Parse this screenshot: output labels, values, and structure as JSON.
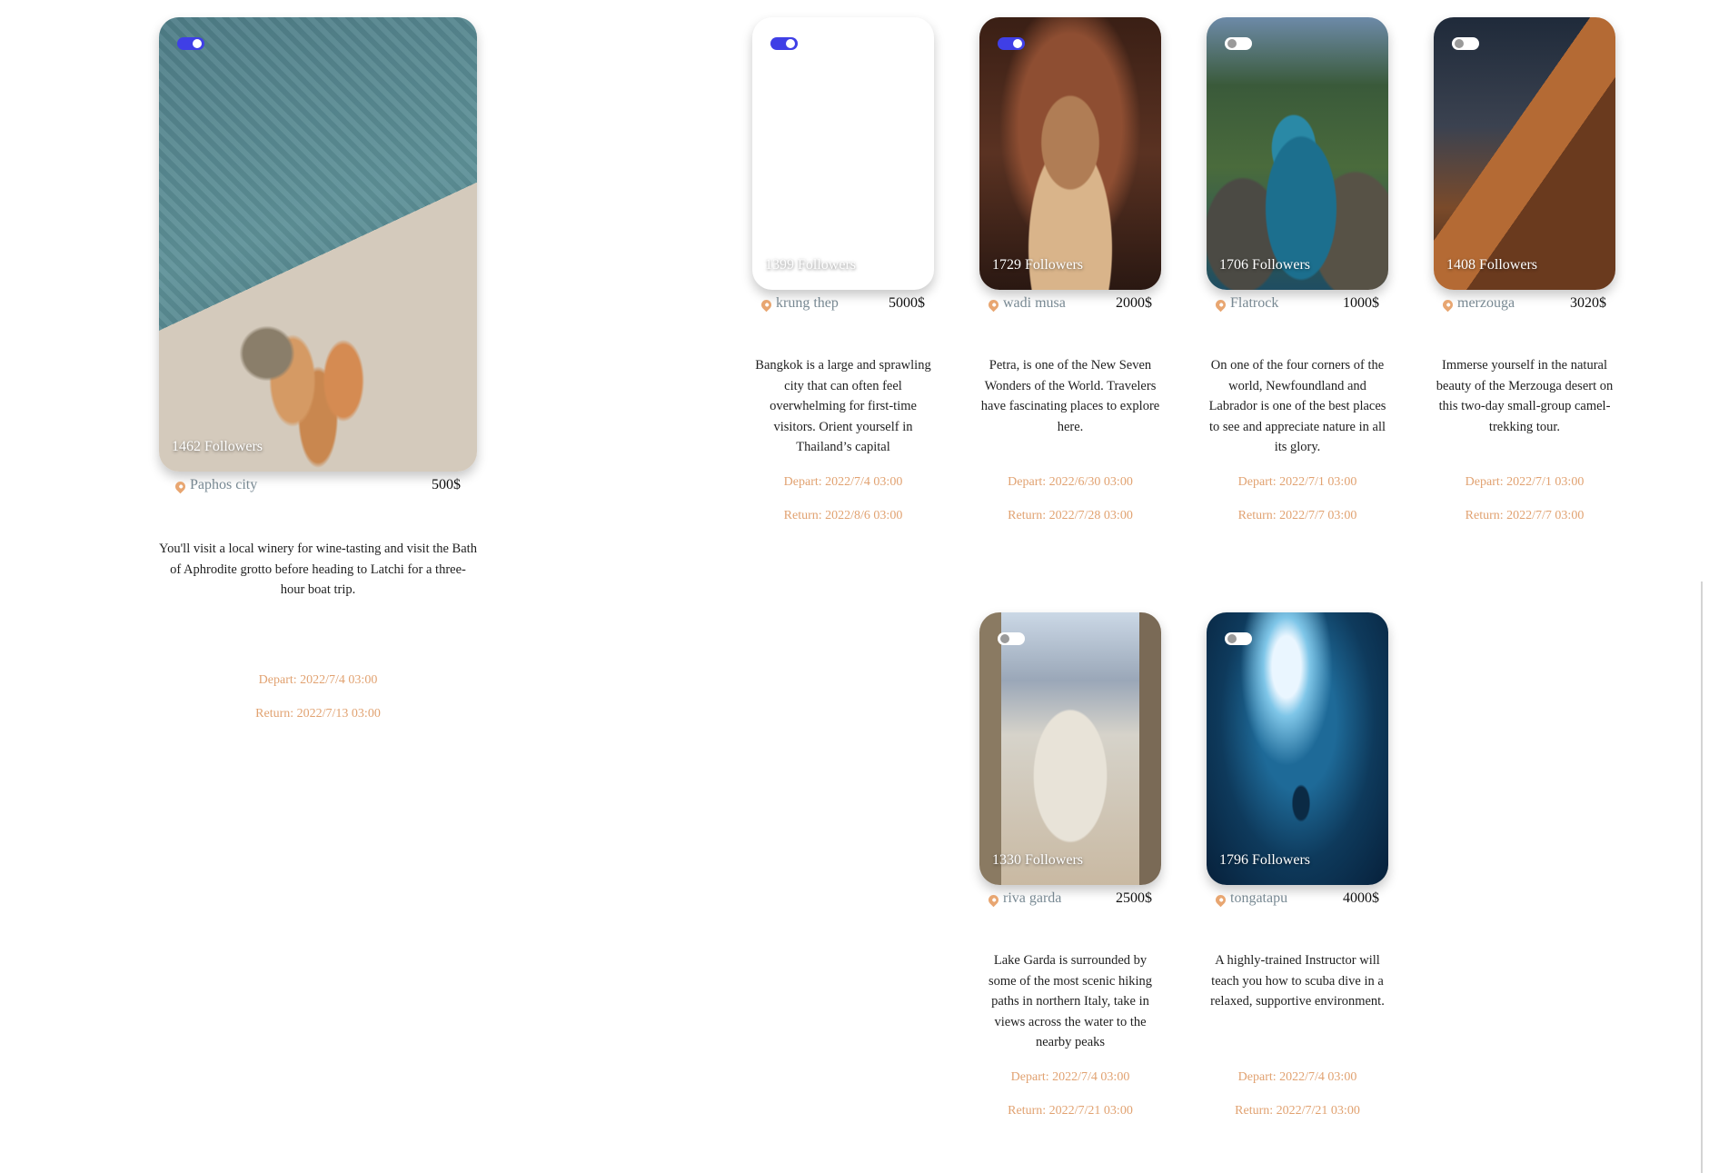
{
  "cards": [
    {
      "toggle_on": true,
      "followers": "1462 Followers",
      "location": "Paphos city",
      "price": "500$",
      "description": "You'll visit a local winery for wine-tasting and visit the Bath of Aphrodite grotto before heading to Latchi for a three-hour boat trip.",
      "depart": "Depart: 2022/7/4 03:00",
      "return": "Return: 2022/7/13 03:00"
    },
    {
      "toggle_on": true,
      "followers": "1399 Followers",
      "location": "krung thep",
      "price": "5000$",
      "description": "Bangkok is a large and sprawling city that can often feel overwhelming for first-time visitors. Orient yourself in Thailand’s capital",
      "depart": "Depart: 2022/7/4 03:00",
      "return": "Return: 2022/8/6 03:00"
    },
    {
      "toggle_on": true,
      "followers": "1729 Followers",
      "location": "wadi musa",
      "price": "2000$",
      "description": "Petra, is one of the New Seven Wonders of the World. Travelers have fascinating places to explore here.",
      "depart": "Depart: 2022/6/30 03:00",
      "return": "Return: 2022/7/28 03:00"
    },
    {
      "toggle_on": false,
      "followers": "1706 Followers",
      "location": "Flatrock",
      "price": "1000$",
      "description": "On one of the four corners of the world, Newfoundland and Labrador is one of the best places to see and appreciate nature in all its glory.",
      "depart": "Depart: 2022/7/1 03:00",
      "return": "Return: 2022/7/7 03:00"
    },
    {
      "toggle_on": false,
      "followers": "1408 Followers",
      "location": "merzouga",
      "price": "3020$",
      "description": "Immerse yourself in the natural beauty of the Merzouga desert on this two-day small-group camel-trekking tour.",
      "depart": "Depart: 2022/7/1 03:00",
      "return": "Return: 2022/7/7 03:00"
    },
    {
      "toggle_on": false,
      "followers": "1330 Followers",
      "location": "riva garda",
      "price": "2500$",
      "description": "Lake Garda is surrounded by some of the most scenic hiking paths in northern Italy, take in views across the water to the nearby peaks",
      "depart": "Depart: 2022/7/4 03:00",
      "return": "Return: 2022/7/21 03:00"
    },
    {
      "toggle_on": false,
      "followers": "1796 Followers",
      "location": "tongatapu",
      "price": "4000$",
      "description": "A highly-trained Instructor will teach you how to scuba dive in a relaxed, supportive environment.",
      "depart": "Depart: 2022/7/4 03:00",
      "return": "Return: 2022/7/21 03:00"
    }
  ],
  "colors": {
    "toggle_on": "#3f3fe6",
    "pin": "#e8a671",
    "location_text": "#7a8b95",
    "dates": "#e1a271"
  }
}
